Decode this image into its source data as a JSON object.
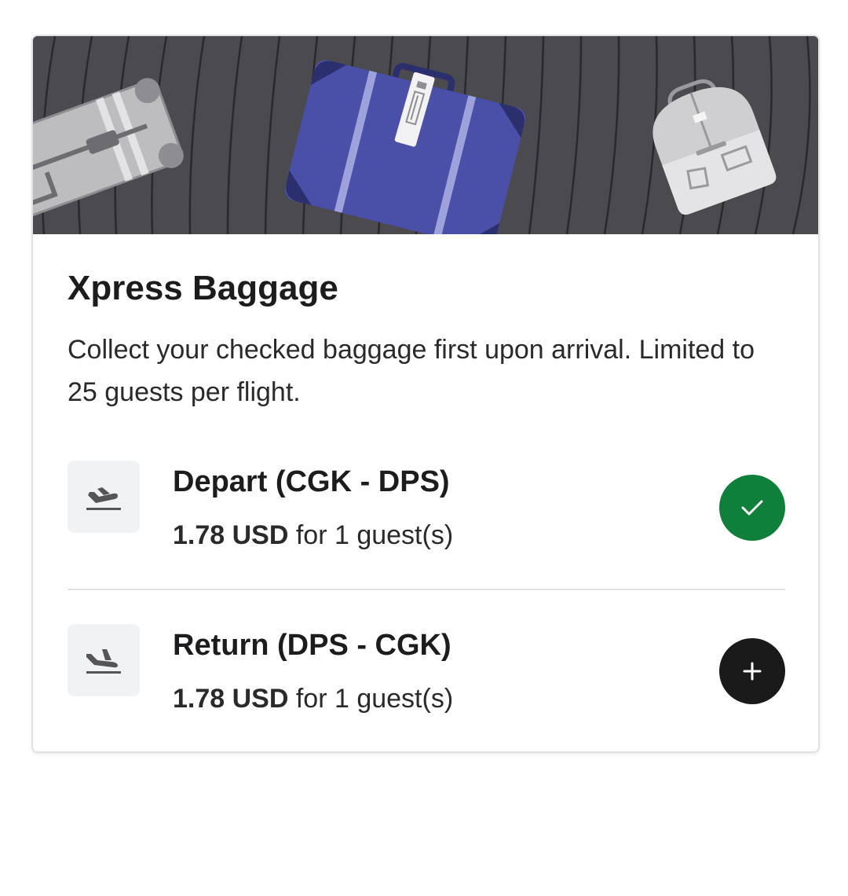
{
  "card": {
    "title": "Xpress Baggage",
    "description": "Collect your checked baggage first upon arrival. Limited to 25 guests per flight."
  },
  "flights": [
    {
      "title": "Depart (CGK - DPS)",
      "price_amount": "1.78 USD",
      "price_suffix": " for 1 guest(s)",
      "icon": "plane-takeoff-icon",
      "selected": true
    },
    {
      "title": "Return (DPS - CGK)",
      "price_amount": "1.78 USD",
      "price_suffix": " for 1 guest(s)",
      "icon": "plane-landing-icon",
      "selected": false
    }
  ],
  "colors": {
    "selected": "#0f7f3c",
    "add": "#1a1a1a",
    "banner_bg": "#4a4a4f",
    "suitcase_blue": "#4a50a8"
  }
}
